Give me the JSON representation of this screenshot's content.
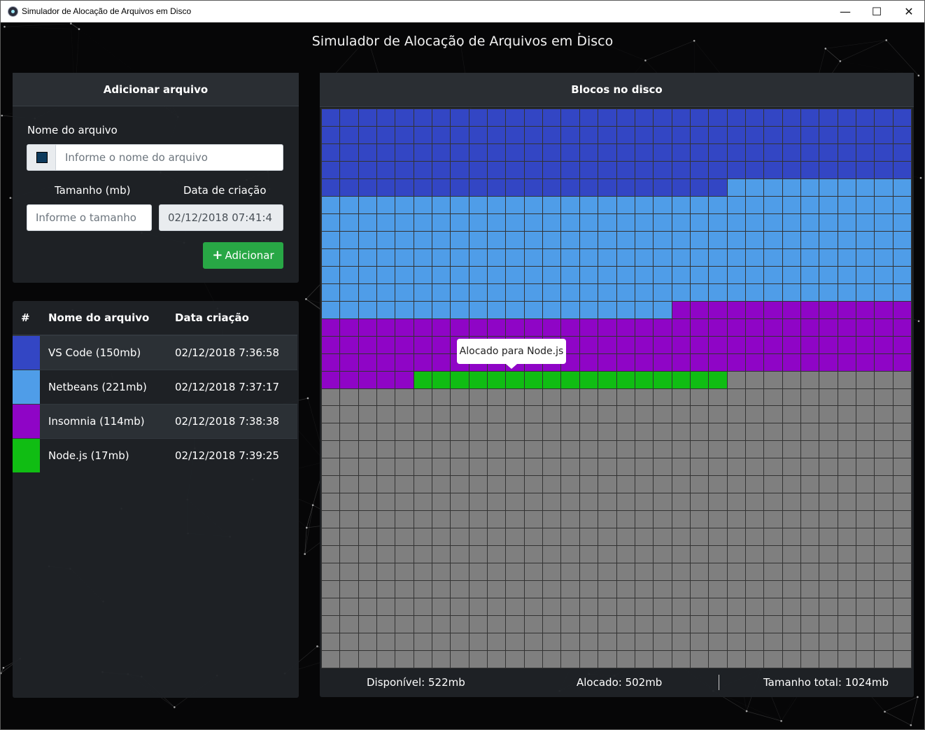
{
  "window": {
    "title": "Simulador de Alocação de Arquivos em Disco",
    "min_glyph": "—",
    "max_glyph": "☐",
    "close_glyph": "✕"
  },
  "app": {
    "title": "Simulador de Alocação de Arquivos em Disco"
  },
  "add_panel": {
    "header": "Adicionar arquivo",
    "name_label": "Nome do arquivo",
    "name_placeholder": "Informe o nome do arquivo",
    "name_value": "",
    "color_swatch": "#0d3a5c",
    "size_label": "Tamanho (mb)",
    "size_placeholder": "Informe o tamanho",
    "size_value": "",
    "date_label": "Data de criação",
    "date_value": "02/12/2018 07:41:4",
    "add_icon": "plus-icon",
    "add_button": "Adicionar"
  },
  "file_table": {
    "columns": [
      "#",
      "Nome do arquivo",
      "Data criação"
    ],
    "rows": [
      {
        "color": "#3346c4",
        "name": "VS Code (150mb)",
        "date": "02/12/2018 7:36:58"
      },
      {
        "color": "#4f9de8",
        "name": "Netbeans (221mb)",
        "date": "02/12/2018 7:37:17"
      },
      {
        "color": "#8f05c6",
        "name": "Insomnia (114mb)",
        "date": "02/12/2018 7:38:38"
      },
      {
        "color": "#10bd13",
        "name": "Node.js (17mb)",
        "date": "02/12/2018 7:39:25"
      }
    ]
  },
  "disk": {
    "header": "Blocos no disco",
    "total_blocks": 1024,
    "free_color": "#7f7f7f",
    "allocations": [
      {
        "color": "#3346c4",
        "start": 0,
        "length": 150
      },
      {
        "color": "#4f9de8",
        "start": 150,
        "length": 221
      },
      {
        "color": "#8f05c6",
        "start": 371,
        "length": 114
      },
      {
        "color": "#10bd13",
        "start": 485,
        "length": 17
      }
    ],
    "tooltip": "Alocado para Node.js",
    "available": "Disponível: 522mb",
    "allocated": "Alocado: 502mb",
    "total": "Tamanho total: 1024mb"
  }
}
